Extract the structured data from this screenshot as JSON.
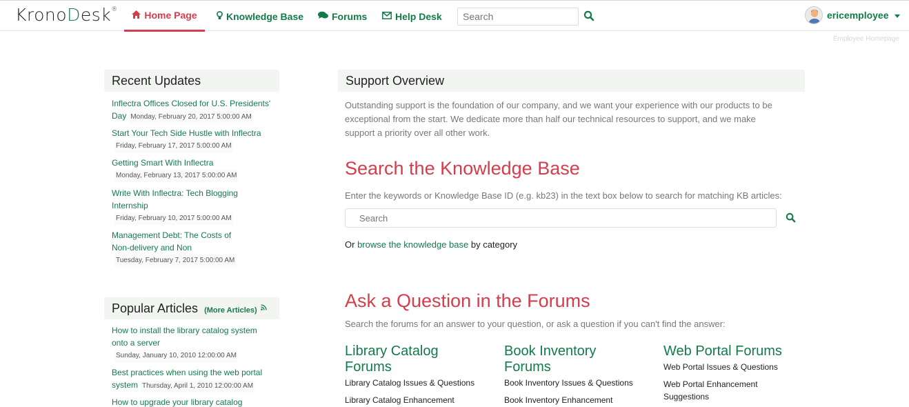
{
  "header": {
    "logo_pre": "Krono",
    "logo_d": "D",
    "logo_post": "esk",
    "logo_reg": "®",
    "nav": [
      {
        "label": "Home Page",
        "icon": "home-icon"
      },
      {
        "label": "Knowledge Base",
        "icon": "lightbulb-icon"
      },
      {
        "label": "Forums",
        "icon": "comments-icon"
      },
      {
        "label": "Help Desk",
        "icon": "envelope-icon"
      }
    ],
    "search_placeholder": "Search",
    "user_name": "ericemployee",
    "employee_homepage": "Employee Homepage"
  },
  "recent": {
    "title": "Recent Updates",
    "items": [
      {
        "title": "Inflectra Offices Closed for U.S. Presidents'",
        "title2": "Day",
        "date": "Monday, February 20, 2017 5:00:00 AM"
      },
      {
        "title": "Start Your Tech Side Hustle with Inflectra",
        "date": "Friday, February 17, 2017 5:00:00 AM"
      },
      {
        "title": "Getting Smart With Inflectra",
        "date": "Monday, February 13, 2017 5:00:00 AM"
      },
      {
        "title": "Write With Inflectra: Tech Blogging",
        "title2": "Internship",
        "date": "Friday, February 10, 2017 5:00:00 AM"
      },
      {
        "title": "Management Debt: The Costs of",
        "title2": "Non-delivery and Non",
        "date": "Tuesday, February 7, 2017 5:00:00 AM"
      }
    ]
  },
  "popular": {
    "title": "Popular Articles",
    "more": "(More Articles)",
    "items": [
      {
        "title": "How to install the library catalog system",
        "title2": "onto a server",
        "date": "Sunday, January 10, 2010 12:00:00 AM"
      },
      {
        "title": "Best practices when using the web portal",
        "title2": "system",
        "date": "Thursday, April 1, 2010 12:00:00 AM"
      },
      {
        "title": "How to upgrade your library catalog"
      }
    ]
  },
  "overview": {
    "title": "Support Overview",
    "line1": "Outstanding support is the foundation of our company, and we want your experience with our products to be",
    "line2": "exceptional from the start. We dedicate more than half our technical resources to support, and we make",
    "line3": "support a priority over all other work."
  },
  "kb": {
    "title": "Search the Knowledge Base",
    "instructions": "Enter the keywords or Knowledge Base ID (e.g. kb23) in the text box below to search for matching KB articles:",
    "placeholder": "Search",
    "browse_pre": "Or ",
    "browse_link": "browse the knowledge base",
    "browse_post": " by category"
  },
  "forums": {
    "title": "Ask a Question in the Forums",
    "subtitle": "Search the forums for an answer to your question, or ask a question if you can't find the answer:",
    "columns": [
      {
        "title1": "Library Catalog",
        "title2": "Forums",
        "links": [
          "Library Catalog Issues & Questions",
          "Library Catalog Enhancement"
        ]
      },
      {
        "title1": "Book Inventory",
        "title2": "Forums",
        "links": [
          "Book Inventory Issues & Questions",
          "Book Inventory Enhancement"
        ]
      },
      {
        "title1": "Web Portal Forums",
        "title2": "",
        "links": [
          "Web Portal Issues & Questions",
          "Web Portal Enhancement",
          "Suggestions"
        ]
      }
    ]
  },
  "colors": {
    "brand_green": "#137a4a",
    "accent_red": "#d43d4c"
  }
}
